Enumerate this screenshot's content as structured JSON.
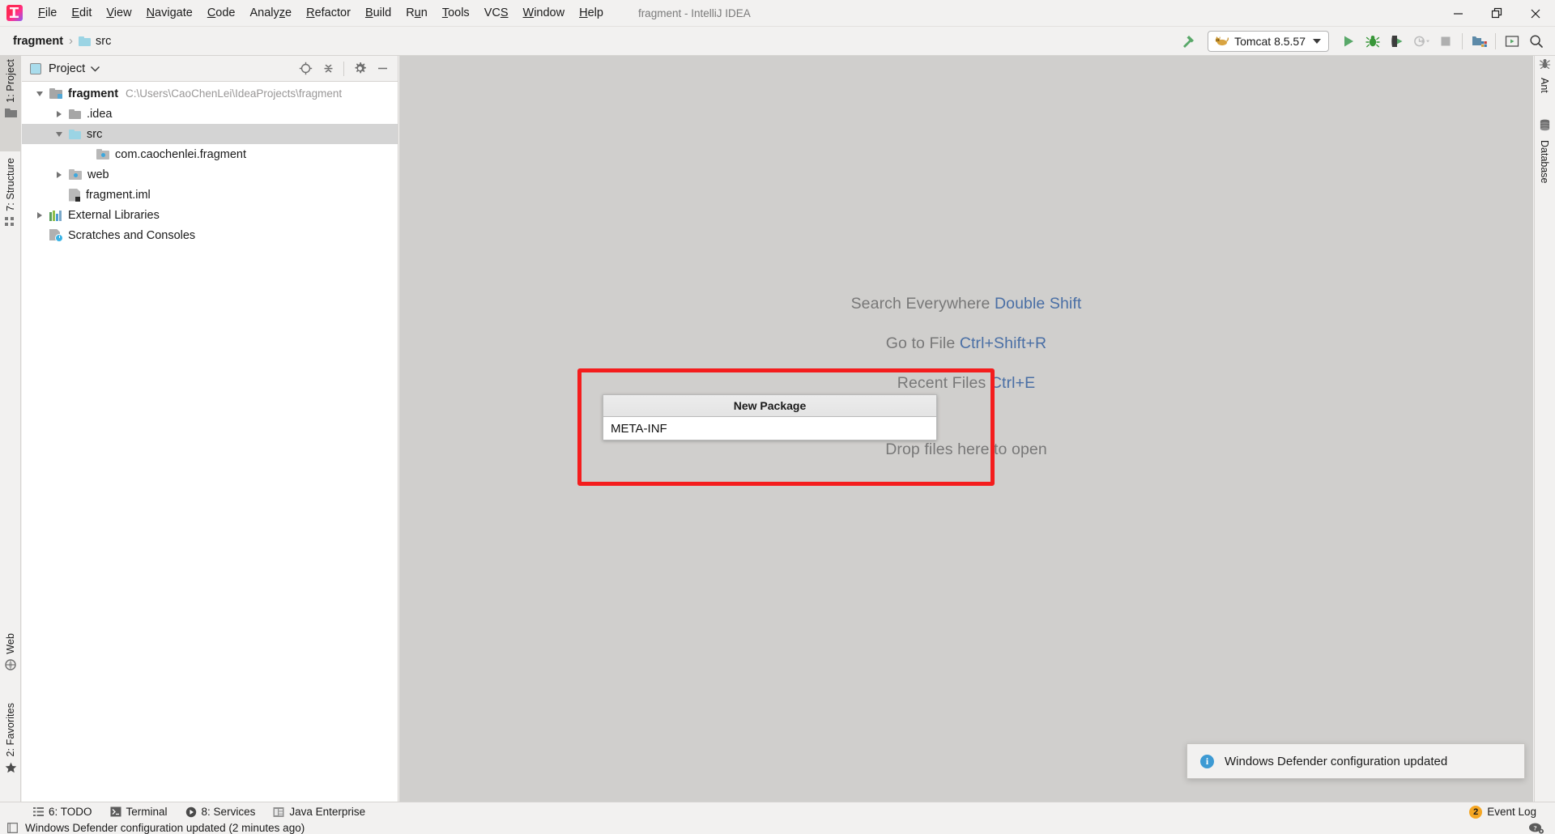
{
  "window": {
    "title": "fragment - IntelliJ IDEA",
    "logo_icon": "intellij-idea-logo",
    "minimize_icon": "minimize-icon",
    "restore_icon": "restore-icon",
    "close_icon": "close-icon"
  },
  "menu": {
    "items": [
      {
        "label": "File",
        "mnemonic": "F"
      },
      {
        "label": "Edit",
        "mnemonic": "E"
      },
      {
        "label": "View",
        "mnemonic": "V"
      },
      {
        "label": "Navigate",
        "mnemonic": "N"
      },
      {
        "label": "Code",
        "mnemonic": "C"
      },
      {
        "label": "Analyze",
        "mnemonic": "z"
      },
      {
        "label": "Refactor",
        "mnemonic": "R"
      },
      {
        "label": "Build",
        "mnemonic": "B"
      },
      {
        "label": "Run",
        "mnemonic": "u"
      },
      {
        "label": "Tools",
        "mnemonic": "T"
      },
      {
        "label": "VCS",
        "mnemonic": "S"
      },
      {
        "label": "Window",
        "mnemonic": "W"
      },
      {
        "label": "Help",
        "mnemonic": "H"
      }
    ]
  },
  "navbar": {
    "breadcrumb": [
      {
        "label": "fragment",
        "icon": "",
        "bold": true
      },
      {
        "label": "src",
        "icon": "folder-icon",
        "bold": false
      }
    ],
    "separator": "›",
    "build_icon": "build-hammer-icon",
    "run_config": {
      "label": "Tomcat 8.5.57",
      "icon": "tomcat-cat-icon",
      "dropdown_icon": "chevron-down-icon"
    },
    "actions": [
      {
        "name": "run-button",
        "icon": "run-play-icon"
      },
      {
        "name": "debug-button",
        "icon": "debug-bug-icon"
      },
      {
        "name": "run-with-coverage-button",
        "icon": "coverage-shield-icon"
      },
      {
        "name": "profiler-button",
        "icon": "profiler-clock-icon"
      },
      {
        "name": "stop-button",
        "icon": "stop-square-icon"
      },
      {
        "name": "project-structure-button",
        "icon": "project-structure-icon"
      },
      {
        "name": "updates-button",
        "icon": "updates-screen-icon"
      },
      {
        "name": "search-everywhere-button",
        "icon": "search-icon"
      }
    ]
  },
  "left_strip": {
    "buttons": [
      {
        "label": "1: Project",
        "icon": "project-folder-icon",
        "active": true
      },
      {
        "label": "7: Structure",
        "icon": "structure-icon",
        "active": false
      },
      {
        "label": "Web",
        "icon": "web-globe-icon",
        "active": false
      },
      {
        "label": "2: Favorites",
        "icon": "favorites-star-icon",
        "active": false
      }
    ]
  },
  "right_strip": {
    "buttons": [
      {
        "label": "Ant",
        "icon": "ant-icon"
      },
      {
        "label": "Database",
        "icon": "database-icon"
      }
    ]
  },
  "project_panel": {
    "title": "Project",
    "view_icon": "project-view-icon",
    "dropdown_icon": "chevron-down-icon",
    "tools": [
      {
        "name": "select-opened-file-button",
        "icon": "target-locate-icon"
      },
      {
        "name": "collapse-all-button",
        "icon": "collapse-all-icon"
      },
      {
        "name": "settings-button",
        "icon": "gear-icon"
      },
      {
        "name": "hide-button",
        "icon": "minimize-icon"
      }
    ],
    "tree": [
      {
        "label": "fragment",
        "path": "C:\\Users\\CaoChenLei\\IdeaProjects\\fragment",
        "indent": 0,
        "arrow": "down",
        "icon": "module-icon",
        "bold": true,
        "selected": false
      },
      {
        "label": ".idea",
        "path": "",
        "indent": 1,
        "arrow": "right",
        "icon": "folder-gray-icon",
        "bold": false,
        "selected": false
      },
      {
        "label": "src",
        "path": "",
        "indent": 1,
        "arrow": "down",
        "icon": "source-folder-icon",
        "bold": false,
        "selected": true
      },
      {
        "label": "com.caochenlei.fragment",
        "path": "",
        "indent": 2,
        "arrow": "none",
        "icon": "package-icon",
        "bold": false,
        "selected": false
      },
      {
        "label": "web",
        "path": "",
        "indent": 1,
        "arrow": "right",
        "icon": "web-folder-icon",
        "bold": false,
        "selected": false
      },
      {
        "label": "fragment.iml",
        "path": "",
        "indent": 1,
        "arrow": "none",
        "icon": "iml-file-icon",
        "bold": false,
        "selected": false
      },
      {
        "label": "External Libraries",
        "path": "",
        "indent": 0,
        "arrow": "right",
        "icon": "library-icon",
        "bold": false,
        "selected": false
      },
      {
        "label": "Scratches and Consoles",
        "path": "",
        "indent": 0,
        "arrow": "none",
        "icon": "scratches-icon",
        "bold": false,
        "selected": false
      }
    ]
  },
  "editor": {
    "hints": [
      {
        "text": "Search Everywhere ",
        "key": "Double Shift"
      },
      {
        "text": "Go to File ",
        "key": "Ctrl+Shift+R"
      },
      {
        "text": "Recent Files ",
        "key": "Ctrl+E"
      },
      {
        "text": "Drop files here to open",
        "key": ""
      }
    ]
  },
  "new_package_dialog": {
    "title": "New Package",
    "input_value": "META-INF"
  },
  "annotation": {
    "highlight_color": "#f41d1d"
  },
  "bottom_bar": {
    "items": [
      {
        "label": "6: TODO",
        "icon": "todo-list-icon"
      },
      {
        "label": "Terminal",
        "icon": "terminal-icon"
      },
      {
        "label": "8: Services",
        "icon": "services-icon"
      },
      {
        "label": "Java Enterprise",
        "icon": "java-enterprise-icon"
      }
    ],
    "event_log": {
      "label": "Event Log",
      "count": "2"
    }
  },
  "status_bar": {
    "message": "Windows Defender configuration updated (2 minutes ago)",
    "icon": "status-window-icon",
    "right_icon": "help-settings-icon"
  },
  "notification": {
    "icon": "info-icon",
    "icon_glyph": "i",
    "message": "Windows Defender configuration updated"
  }
}
